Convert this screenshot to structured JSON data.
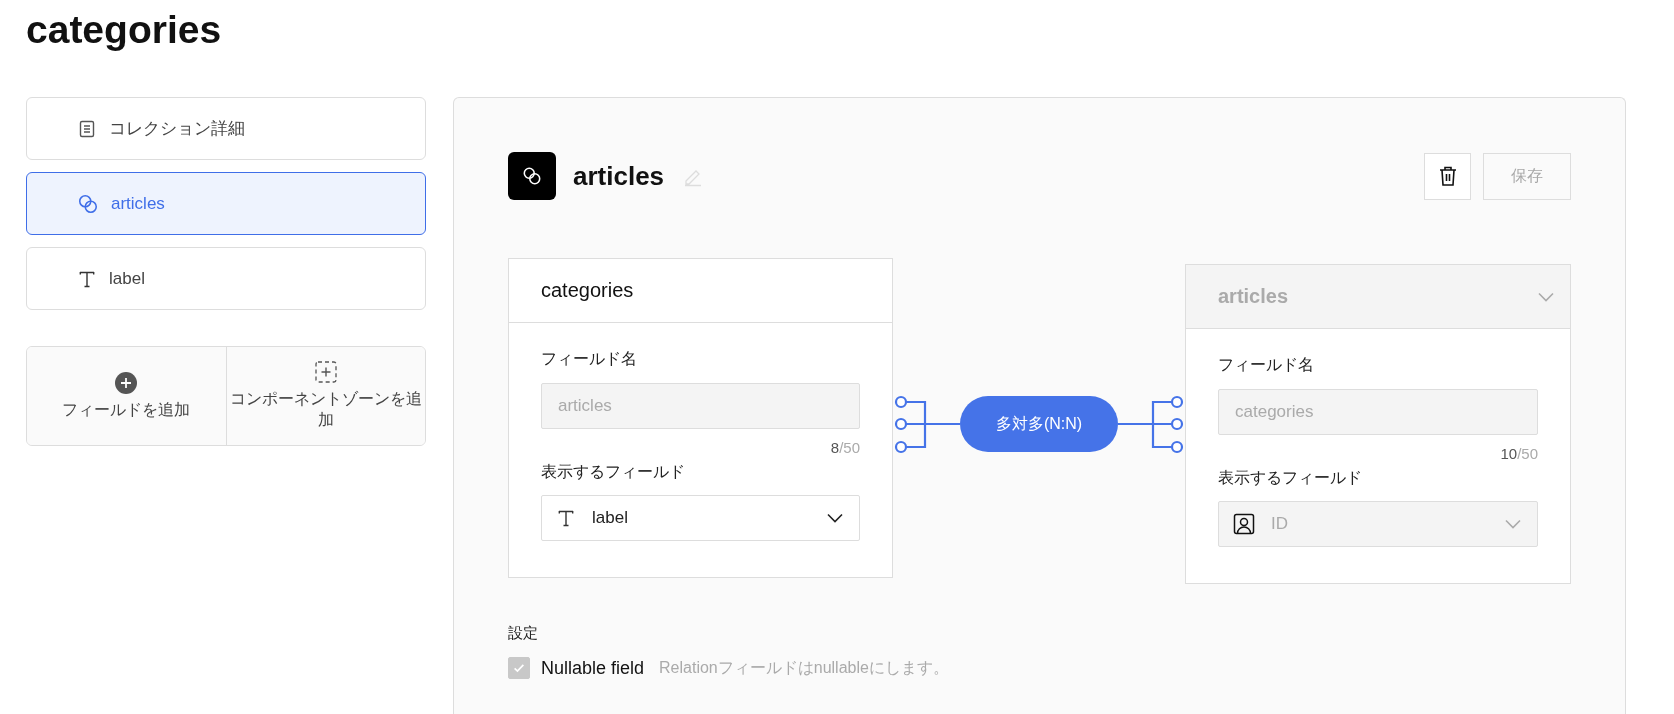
{
  "page_title": "categories",
  "sidebar": {
    "items": [
      {
        "label": "コレクション詳細",
        "kind": "details",
        "selected": false
      },
      {
        "label": "articles",
        "kind": "relation",
        "selected": true
      },
      {
        "label": "label",
        "kind": "text",
        "selected": false
      }
    ],
    "add_buttons": [
      {
        "label": "フィールドを追加",
        "kind": "field"
      },
      {
        "label": "コンポーネントゾーンを追加",
        "kind": "zone"
      }
    ]
  },
  "editor": {
    "field_title": "articles",
    "save_button": {
      "label": "保存",
      "disabled": true
    },
    "source": {
      "collection": "categories",
      "collection_disabled": false,
      "field_name_label": "フィールド名",
      "field_name_value": "articles",
      "count": "8",
      "limit": "/50",
      "display_label": "表示するフィールド",
      "display_field": {
        "kind": "text",
        "label": "label",
        "disabled": false
      }
    },
    "relation": "多対多(N:N)",
    "target": {
      "collection": "articles",
      "collection_disabled": true,
      "field_name_label": "フィールド名",
      "field_name_value": "categories",
      "count": "10",
      "limit": "/50",
      "display_label": "表示するフィールド",
      "display_field": {
        "kind": "id",
        "label": "ID",
        "disabled": true
      }
    },
    "settings": {
      "heading": "設定",
      "options": [
        {
          "label": "Nullable field",
          "description": "Relationフィールドはnullableにします。",
          "checked": true,
          "disabled": true
        }
      ]
    }
  }
}
